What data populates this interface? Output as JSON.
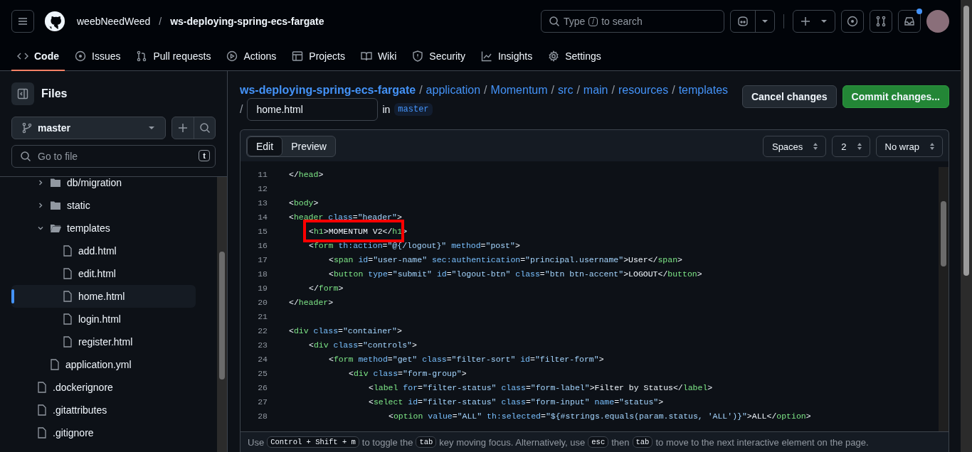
{
  "header": {
    "owner": "weebNeedWeed",
    "separator": "/",
    "repo": "ws-deploying-spring-ecs-fargate",
    "search": {
      "placeholder_before": "Type",
      "key": "/",
      "placeholder_after": "to search"
    },
    "inbox_unread": true
  },
  "repo_tabs": [
    {
      "label": "Code",
      "selected": true
    },
    {
      "label": "Issues",
      "selected": false
    },
    {
      "label": "Pull requests",
      "selected": false
    },
    {
      "label": "Actions",
      "selected": false
    },
    {
      "label": "Projects",
      "selected": false
    },
    {
      "label": "Wiki",
      "selected": false
    },
    {
      "label": "Security",
      "selected": false
    },
    {
      "label": "Insights",
      "selected": false
    },
    {
      "label": "Settings",
      "selected": false
    }
  ],
  "sidebar": {
    "title": "Files",
    "branch": "master",
    "filter": {
      "placeholder": "Go to file",
      "key": "t"
    },
    "tree": [
      {
        "children": [
          {
            "label": "db/migration",
            "kind": "folder",
            "expanded": false,
            "selected": false
          },
          {
            "label": "static",
            "kind": "folder",
            "expanded": false,
            "selected": false
          },
          {
            "label": "templates",
            "kind": "folder",
            "expanded": true,
            "selected": false,
            "children": [
              {
                "label": "add.html",
                "kind": "file",
                "selected": false
              },
              {
                "label": "edit.html",
                "kind": "file",
                "selected": false
              },
              {
                "label": "home.html",
                "kind": "file",
                "selected": true
              },
              {
                "label": "login.html",
                "kind": "file",
                "selected": false
              },
              {
                "label": "register.html",
                "kind": "file",
                "selected": false
              }
            ]
          },
          {
            "label": "application.yml",
            "kind": "file",
            "selected": false
          }
        ]
      },
      {
        "label": ".dockerignore",
        "kind": "file",
        "selected": false
      },
      {
        "label": ".gitattributes",
        "kind": "file",
        "selected": false
      },
      {
        "label": ".gitignore",
        "kind": "file",
        "selected": false
      }
    ]
  },
  "breadcrumb": [
    {
      "label": "ws-deploying-spring-ecs-fargate",
      "kind": "repo"
    },
    {
      "separator": "/",
      "label": "application",
      "kind": "dir"
    },
    {
      "separator": "/",
      "label": "Momentum",
      "kind": "dir"
    },
    {
      "separator": "/",
      "label": "src",
      "kind": "dir"
    },
    {
      "separator": "/",
      "label": "main",
      "kind": "dir"
    },
    {
      "separator": "/",
      "label": "resources",
      "kind": "dir"
    },
    {
      "separator": "/",
      "label": "templates",
      "kind": "dir"
    }
  ],
  "filename": {
    "separator": "/",
    "value": "home.html",
    "in": "in",
    "branch": "master"
  },
  "actions": [
    {
      "label": "Cancel changes",
      "kind": "secondary"
    },
    {
      "label": "Commit changes...",
      "kind": "primary"
    }
  ],
  "editor_tabs": [
    {
      "label": "Edit",
      "selected": true
    },
    {
      "label": "Preview",
      "selected": false
    }
  ],
  "editor_options": [
    "Spaces",
    "2",
    "No wrap"
  ],
  "code_lines": [
    {
      "number": "11",
      "text": "</head>"
    },
    {
      "number": "12"
    },
    {
      "number": "13",
      "text": "<body>"
    },
    {
      "number": "14",
      "text": "<header class=\"header\">",
      "children": [
        {
          "number": "15",
          "text": "<h1>MOMENTUM V2</h1>",
          "highlighted": true
        },
        {
          "number": "16",
          "text": "<form th:action=\"@{/logout}\" method=\"post\">",
          "children": [
            {
              "number": "17",
              "text": "<span id=\"user-name\" sec:authentication=\"principal.username\">User</span>"
            },
            {
              "number": "18",
              "text": "<button type=\"submit\" id=\"logout-btn\" class=\"btn btn-accent\">LOGOUT</button>"
            }
          ]
        },
        {
          "number": "19",
          "text": "</form>"
        }
      ]
    },
    {
      "number": "20",
      "text": "</header>"
    },
    {
      "number": "21"
    },
    {
      "number": "22",
      "text": "<div class=\"container\">",
      "children": [
        {
          "number": "23",
          "text": "<div class=\"controls\">",
          "children": [
            {
              "number": "24",
              "text": "<form method=\"get\" class=\"filter-sort\" id=\"filter-form\">",
              "children": [
                {
                  "number": "25",
                  "text": "<div class=\"form-group\">",
                  "children": [
                    {
                      "number": "26",
                      "text": "<label for=\"filter-status\" class=\"form-label\">Filter by Status</label>"
                    },
                    {
                      "number": "27",
                      "text": "<select id=\"filter-status\" class=\"form-input\" name=\"status\">",
                      "children": [
                        {
                          "number": "28",
                          "text": "<option value=\"ALL\" th:selected=\"${#strings.equals(param.status, 'ALL')}\">ALL</option>"
                        }
                      ]
                    }
                  ]
                }
              ]
            }
          ]
        }
      ]
    }
  ],
  "footer_hint": [
    {
      "text": "Use",
      "kind": "text"
    },
    {
      "text": "Control + Shift + m",
      "kind": "key"
    },
    {
      "text": "to toggle the",
      "kind": "text"
    },
    {
      "text": "tab",
      "kind": "key"
    },
    {
      "text": "key moving focus. Alternatively, use",
      "kind": "text"
    },
    {
      "text": "esc",
      "kind": "key"
    },
    {
      "text": "then",
      "kind": "text"
    },
    {
      "text": "tab",
      "kind": "key"
    },
    {
      "text": "to move to the next interactive element on the page.",
      "kind": "text"
    }
  ]
}
